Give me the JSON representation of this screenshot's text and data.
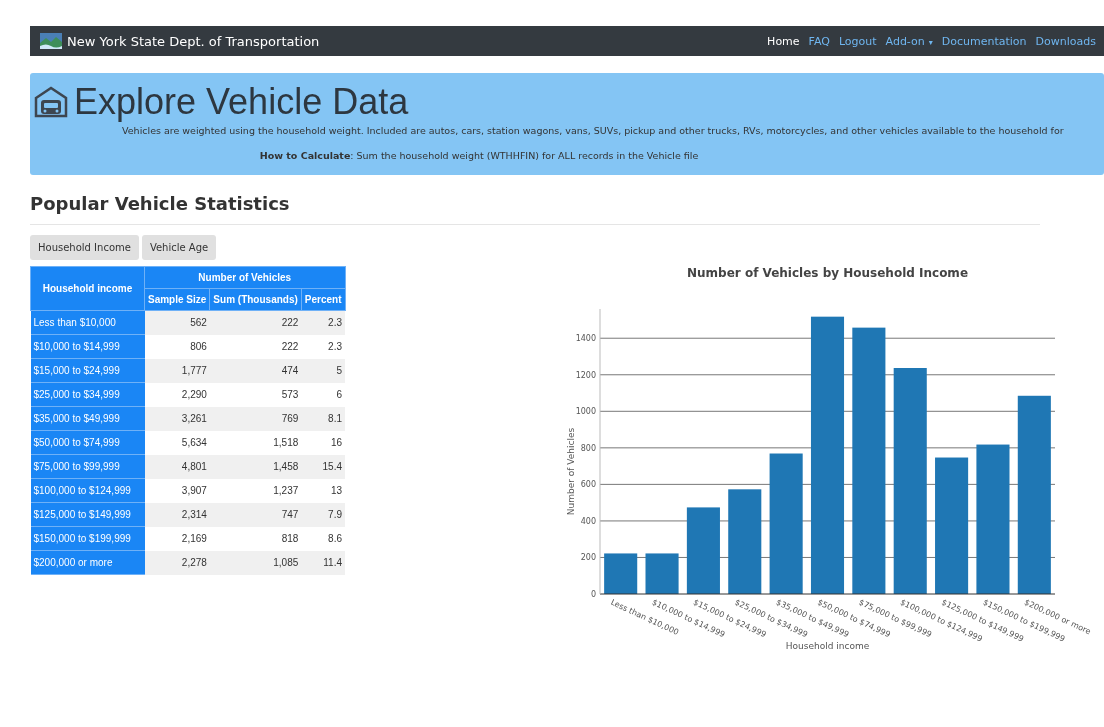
{
  "navbar": {
    "brand": "New York State Dept. of Transportation",
    "links": [
      {
        "label": "Home",
        "selected": true
      },
      {
        "label": "FAQ",
        "selected": false
      },
      {
        "label": "Logout",
        "selected": false
      },
      {
        "label": "Add-on",
        "selected": false,
        "caret": "▾"
      },
      {
        "label": "Documentation",
        "selected": false
      },
      {
        "label": "Downloads",
        "selected": false
      }
    ]
  },
  "banner": {
    "title": "Explore Vehicle Data",
    "description": "Vehicles are weighted using the household weight. Included are autos, cars, station wagons, vans, SUVs, pickup and other trucks, RVs, motorcycles, and other vehicles available to the household for",
    "how_to": "**How to Calculate**: Sum the household weight (WTHHFIN) for ALL records in the Vehicle file"
  },
  "section_title": "Popular Vehicle Statistics",
  "buttons": [
    "Household Income",
    "Vehicle Age"
  ],
  "table": {
    "row_header": "Household income",
    "group_header": "Number of Vehicles",
    "columns": [
      "Sample Size",
      "Sum (Thousands)",
      "Percent"
    ],
    "rows": [
      {
        "label": "Less than $10,000",
        "cells": [
          "562",
          "222",
          "2.3"
        ]
      },
      {
        "label": "$10,000 to $14,999",
        "cells": [
          "806",
          "222",
          "2.3"
        ]
      },
      {
        "label": "$15,000 to $24,999",
        "cells": [
          "1,777",
          "474",
          "5"
        ]
      },
      {
        "label": "$25,000 to $34,999",
        "cells": [
          "2,290",
          "573",
          "6"
        ]
      },
      {
        "label": "$35,000 to $49,999",
        "cells": [
          "3,261",
          "769",
          "8.1"
        ]
      },
      {
        "label": "$50,000 to $74,999",
        "cells": [
          "5,634",
          "1,518",
          "16"
        ]
      },
      {
        "label": "$75,000 to $99,999",
        "cells": [
          "4,801",
          "1,458",
          "15.4"
        ]
      },
      {
        "label": "$100,000 to $124,999",
        "cells": [
          "3,907",
          "1,237",
          "13"
        ]
      },
      {
        "label": "$125,000 to $149,999",
        "cells": [
          "2,314",
          "747",
          "7.9"
        ]
      },
      {
        "label": "$150,000 to $199,999",
        "cells": [
          "2,169",
          "818",
          "8.6"
        ]
      },
      {
        "label": "$200,000 or more",
        "cells": [
          "2,278",
          "1,085",
          "11.4"
        ]
      }
    ]
  },
  "chart": {
    "chart_data": {
      "type": "bar",
      "title": "Number of Vehicles by Household Income",
      "xlabel": "Household income",
      "ylabel": "Number of Vehicles",
      "categories": [
        "Less than $10,000",
        "$10,000 to $14,999",
        "$15,000 to $24,999",
        "$25,000 to $34,999",
        "$35,000 to $49,999",
        "$50,000 to $74,999",
        "$75,000 to $99,999",
        "$100,000 to $124,999",
        "$125,000 to $149,999",
        "$150,000 to $199,999",
        "$200,000 or more"
      ],
      "values": [
        222,
        222,
        474,
        573,
        769,
        1518,
        1458,
        1237,
        747,
        818,
        1085
      ],
      "grid": true,
      "ylim": [
        0,
        1560
      ],
      "yticks": [
        0,
        200,
        400,
        600,
        800,
        1000,
        1200,
        1400
      ]
    }
  }
}
